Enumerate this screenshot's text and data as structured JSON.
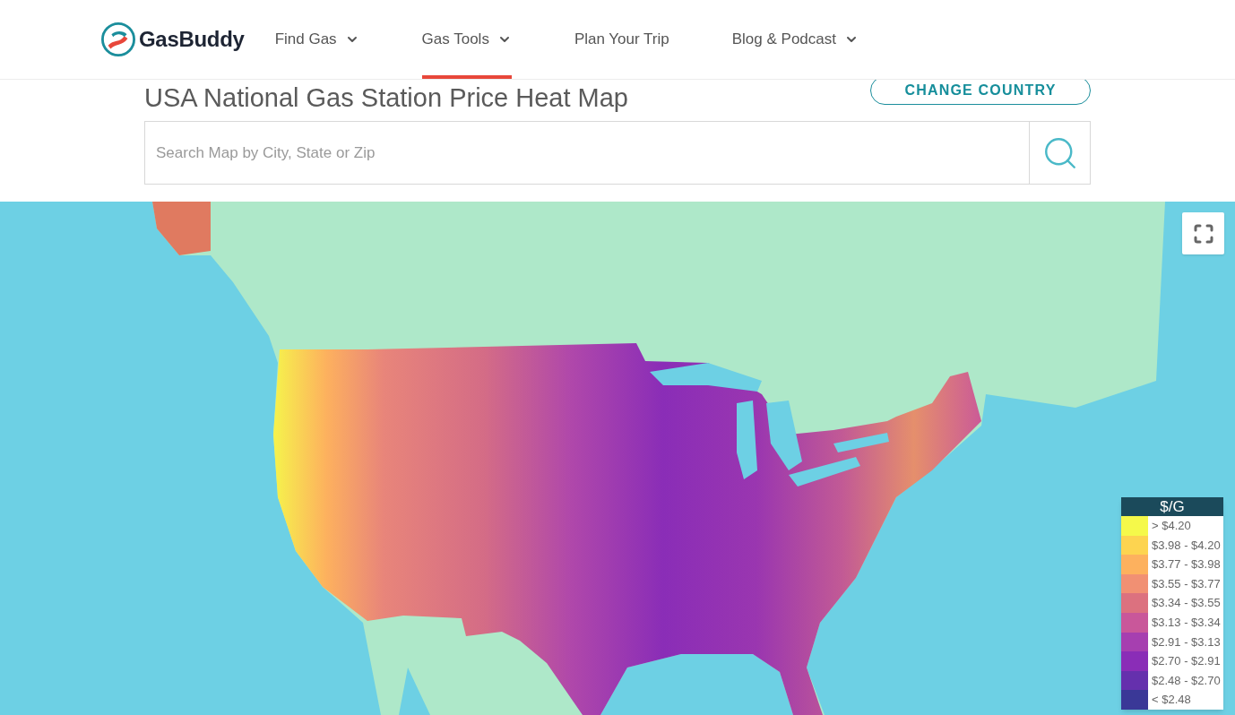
{
  "header": {
    "logo": {
      "text": "GasBuddy"
    },
    "nav": [
      {
        "label": "Find Gas",
        "dropdown": true,
        "selected": false
      },
      {
        "label": "Gas Tools",
        "dropdown": true,
        "selected": true
      },
      {
        "label": "Plan Your Trip",
        "dropdown": false,
        "selected": false
      },
      {
        "label": "Blog & Podcast",
        "dropdown": true,
        "selected": false
      }
    ]
  },
  "page": {
    "title": "USA National Gas Station Price Heat Map",
    "change_country": "CHANGE COUNTRY",
    "search": {
      "placeholder": "Search Map by City, State or Zip"
    }
  },
  "map": {
    "legend": {
      "title": "$/G",
      "items": [
        {
          "label": "> $4.20",
          "color": "#f5f94a"
        },
        {
          "label": "$3.98 - $4.20",
          "color": "#fdd450"
        },
        {
          "label": "$3.77 - $3.98",
          "color": "#fdb15e"
        },
        {
          "label": "$3.55 - $3.77",
          "color": "#f19073"
        },
        {
          "label": "$3.34 - $3.55",
          "color": "#dc717f"
        },
        {
          "label": "$3.13 - $3.34",
          "color": "#c9579a"
        },
        {
          "label": "$2.91 - $3.13",
          "color": "#a63fb0"
        },
        {
          "label": "$2.70 - $2.91",
          "color": "#8a2db7"
        },
        {
          "label": "$2.48 - $2.70",
          "color": "#6530ad"
        },
        {
          "label": "< $2.48",
          "color": "#3a3897"
        }
      ]
    }
  }
}
